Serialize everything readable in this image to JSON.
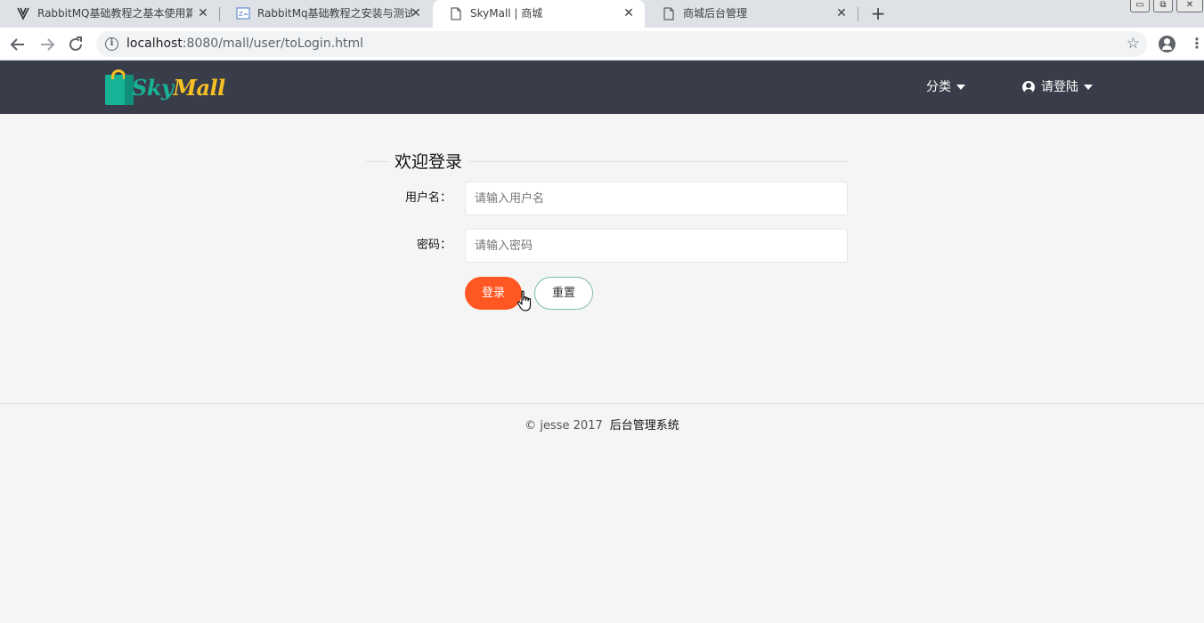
{
  "browser": {
    "tabs": [
      {
        "title": "RabbitMQ基础教程之基本使用篇",
        "active": false
      },
      {
        "title": "RabbitMq基础教程之安装与测试",
        "active": false
      },
      {
        "title": "SkyMall | 商城",
        "active": true
      },
      {
        "title": "商城后台管理",
        "active": false
      }
    ],
    "new_tab_label": "+",
    "close_glyph": "✕",
    "window_controls": {
      "minimize": "▭",
      "restore": "⧉",
      "close": "✕"
    },
    "url": {
      "host": "localhost",
      "rest": ":8080/mall/user/toLogin.html"
    },
    "icons": {
      "back": "back-arrow-icon",
      "forward": "forward-arrow-icon",
      "reload": "reload-icon",
      "info": "info-icon",
      "bookmark": "star-icon",
      "profile": "profile-icon",
      "menu": "kebab-menu-icon"
    }
  },
  "site": {
    "logo": {
      "part1": "Sky",
      "part2": "Mall"
    },
    "nav": {
      "category_label": "分类",
      "user_label": "请登陆"
    },
    "colors": {
      "navbar": "#393d49",
      "primary": "#ff5722",
      "brand_green": "#16b397",
      "brand_yellow": "#f7c023"
    }
  },
  "login": {
    "title": "欢迎登录",
    "username_label": "用户名：",
    "username_placeholder": "请输入用户名",
    "username_value": "",
    "password_label": "密码：",
    "password_placeholder": "请输入密码",
    "password_value": "",
    "login_button": "登录",
    "reset_button": "重置"
  },
  "footer": {
    "copyright": "© jesse 2017",
    "admin_link": "后台管理系统"
  }
}
